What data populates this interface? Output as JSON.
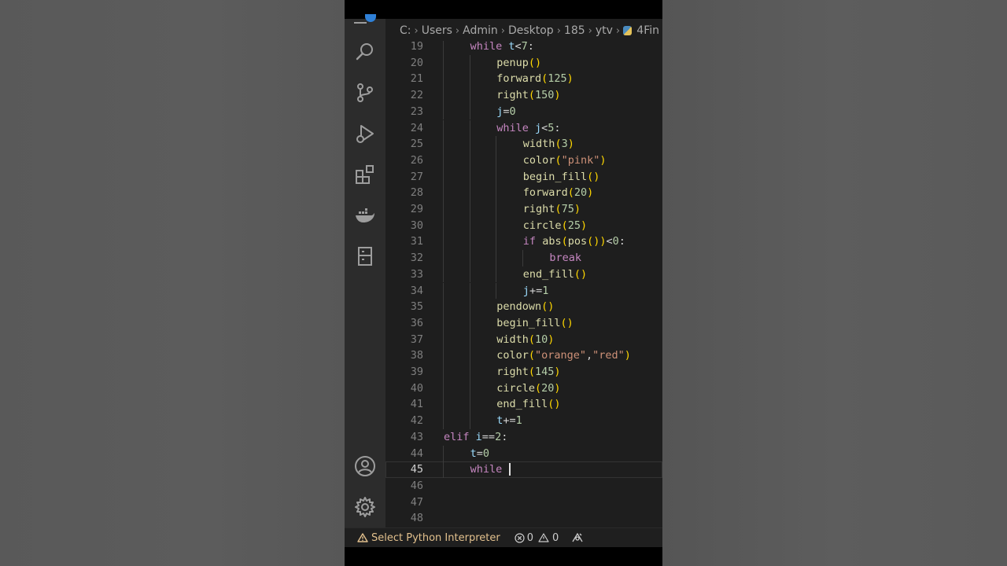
{
  "breadcrumb": {
    "drive": "C:",
    "users": "Users",
    "admin": "Admin",
    "desktop": "Desktop",
    "folder": "185",
    "sub": "ytv",
    "file": "4Fin"
  },
  "activity_icons": [
    "explorer-icon",
    "search-icon",
    "source-control-icon",
    "run-debug-icon",
    "extensions-icon",
    "docker-icon",
    "remote-explorer-icon",
    "account-icon",
    "settings-gear-icon"
  ],
  "code": {
    "current_line": 45,
    "lines": [
      {
        "n": "19",
        "indent": 2,
        "tokens": [
          [
            "kw",
            "while"
          ],
          [
            "op",
            " "
          ],
          [
            "var",
            "t"
          ],
          [
            "op",
            "<"
          ],
          [
            "num",
            "7"
          ],
          [
            "op",
            ":"
          ]
        ]
      },
      {
        "n": "20",
        "indent": 3,
        "tokens": [
          [
            "fn",
            "penup"
          ],
          [
            "par",
            "()"
          ]
        ]
      },
      {
        "n": "21",
        "indent": 3,
        "tokens": [
          [
            "fn",
            "forward"
          ],
          [
            "par",
            "("
          ],
          [
            "num",
            "125"
          ],
          [
            "par",
            ")"
          ]
        ]
      },
      {
        "n": "22",
        "indent": 3,
        "tokens": [
          [
            "fn",
            "right"
          ],
          [
            "par",
            "("
          ],
          [
            "num",
            "150"
          ],
          [
            "par",
            ")"
          ]
        ]
      },
      {
        "n": "23",
        "indent": 3,
        "tokens": [
          [
            "var",
            "j"
          ],
          [
            "op",
            "="
          ],
          [
            "num",
            "0"
          ]
        ]
      },
      {
        "n": "24",
        "indent": 3,
        "tokens": [
          [
            "kw",
            "while"
          ],
          [
            "op",
            " "
          ],
          [
            "var",
            "j"
          ],
          [
            "op",
            "<"
          ],
          [
            "num",
            "5"
          ],
          [
            "op",
            ":"
          ]
        ]
      },
      {
        "n": "25",
        "indent": 4,
        "tokens": [
          [
            "fn",
            "width"
          ],
          [
            "par",
            "("
          ],
          [
            "num",
            "3"
          ],
          [
            "par",
            ")"
          ]
        ]
      },
      {
        "n": "26",
        "indent": 4,
        "tokens": [
          [
            "fn",
            "color"
          ],
          [
            "par",
            "("
          ],
          [
            "str",
            "\"pink\""
          ],
          [
            "par",
            ")"
          ]
        ]
      },
      {
        "n": "27",
        "indent": 4,
        "tokens": [
          [
            "fn",
            "begin_fill"
          ],
          [
            "par",
            "()"
          ]
        ]
      },
      {
        "n": "28",
        "indent": 4,
        "tokens": [
          [
            "fn",
            "forward"
          ],
          [
            "par",
            "("
          ],
          [
            "num",
            "20"
          ],
          [
            "par",
            ")"
          ]
        ]
      },
      {
        "n": "29",
        "indent": 4,
        "tokens": [
          [
            "fn",
            "right"
          ],
          [
            "par",
            "("
          ],
          [
            "num",
            "75"
          ],
          [
            "par",
            ")"
          ]
        ]
      },
      {
        "n": "30",
        "indent": 4,
        "tokens": [
          [
            "fn",
            "circle"
          ],
          [
            "par",
            "("
          ],
          [
            "num",
            "25"
          ],
          [
            "par",
            ")"
          ]
        ]
      },
      {
        "n": "31",
        "indent": 4,
        "tokens": [
          [
            "kw",
            "if"
          ],
          [
            "op",
            " "
          ],
          [
            "fn",
            "abs"
          ],
          [
            "par",
            "("
          ],
          [
            "fn",
            "pos"
          ],
          [
            "par",
            "())"
          ],
          [
            "op",
            "<"
          ],
          [
            "num",
            "0"
          ],
          [
            "op",
            ":"
          ]
        ]
      },
      {
        "n": "32",
        "indent": 5,
        "tokens": [
          [
            "kw",
            "break"
          ]
        ]
      },
      {
        "n": "33",
        "indent": 4,
        "tokens": [
          [
            "fn",
            "end_fill"
          ],
          [
            "par",
            "()"
          ]
        ]
      },
      {
        "n": "34",
        "indent": 4,
        "tokens": [
          [
            "var",
            "j"
          ],
          [
            "op",
            "+="
          ],
          [
            "num",
            "1"
          ]
        ]
      },
      {
        "n": "35",
        "indent": 3,
        "tokens": [
          [
            "fn",
            "pendown"
          ],
          [
            "par",
            "()"
          ]
        ]
      },
      {
        "n": "36",
        "indent": 3,
        "tokens": [
          [
            "fn",
            "begin_fill"
          ],
          [
            "par",
            "()"
          ]
        ]
      },
      {
        "n": "37",
        "indent": 3,
        "tokens": [
          [
            "fn",
            "width"
          ],
          [
            "par",
            "("
          ],
          [
            "num",
            "10"
          ],
          [
            "par",
            ")"
          ]
        ]
      },
      {
        "n": "38",
        "indent": 3,
        "tokens": [
          [
            "fn",
            "color"
          ],
          [
            "par",
            "("
          ],
          [
            "str",
            "\"orange\""
          ],
          [
            "op",
            ","
          ],
          [
            "str",
            "\"red\""
          ],
          [
            "par",
            ")"
          ]
        ]
      },
      {
        "n": "39",
        "indent": 3,
        "tokens": [
          [
            "fn",
            "right"
          ],
          [
            "par",
            "("
          ],
          [
            "num",
            "145"
          ],
          [
            "par",
            ")"
          ]
        ]
      },
      {
        "n": "40",
        "indent": 3,
        "tokens": [
          [
            "fn",
            "circle"
          ],
          [
            "par",
            "("
          ],
          [
            "num",
            "20"
          ],
          [
            "par",
            ")"
          ]
        ]
      },
      {
        "n": "41",
        "indent": 3,
        "tokens": [
          [
            "fn",
            "end_fill"
          ],
          [
            "par",
            "()"
          ]
        ]
      },
      {
        "n": "42",
        "indent": 3,
        "tokens": [
          [
            "var",
            "t"
          ],
          [
            "op",
            "+="
          ],
          [
            "num",
            "1"
          ]
        ]
      },
      {
        "n": "43",
        "indent": 1,
        "tokens": [
          [
            "kw",
            "elif"
          ],
          [
            "op",
            " "
          ],
          [
            "var",
            "i"
          ],
          [
            "op",
            "=="
          ],
          [
            "num",
            "2"
          ],
          [
            "op",
            ":"
          ]
        ]
      },
      {
        "n": "44",
        "indent": 2,
        "tokens": [
          [
            "var",
            "t"
          ],
          [
            "op",
            "="
          ],
          [
            "num",
            "0"
          ]
        ]
      },
      {
        "n": "45",
        "indent": 2,
        "tokens": [
          [
            "kw",
            "while"
          ],
          [
            "op",
            " "
          ]
        ]
      },
      {
        "n": "46",
        "indent": 0,
        "tokens": []
      },
      {
        "n": "47",
        "indent": 0,
        "tokens": []
      },
      {
        "n": "48",
        "indent": 0,
        "tokens": []
      }
    ]
  },
  "status": {
    "interpreter": "Select Python Interpreter",
    "errors": "0",
    "warnings": "0"
  },
  "colors": {
    "warning": "#e2c08d",
    "editor_bg": "#1e1e1e",
    "activity_bg": "#2c2c2c"
  }
}
